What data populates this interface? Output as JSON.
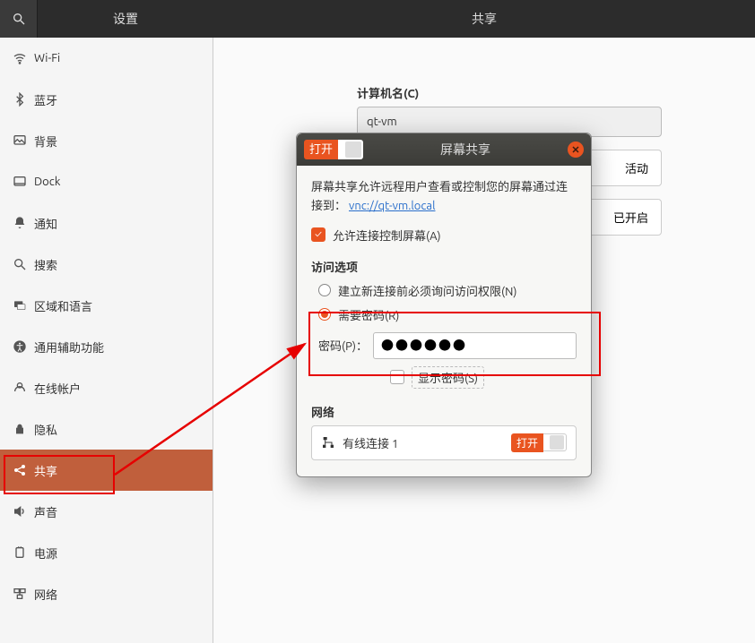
{
  "topbar": {
    "sidebar_title": "设置",
    "page_title": "共享"
  },
  "sidebar": {
    "items": [
      {
        "label": "Wi-Fi",
        "icon": "wifi-icon"
      },
      {
        "label": "蓝牙",
        "icon": "bluetooth-icon"
      },
      {
        "label": "背景",
        "icon": "background-icon"
      },
      {
        "label": "Dock",
        "icon": "dock-icon"
      },
      {
        "label": "通知",
        "icon": "bell-icon"
      },
      {
        "label": "搜索",
        "icon": "search-icon"
      },
      {
        "label": "区域和语言",
        "icon": "language-icon"
      },
      {
        "label": "通用辅助功能",
        "icon": "accessibility-icon"
      },
      {
        "label": "在线帐户",
        "icon": "online-accounts-icon"
      },
      {
        "label": "隐私",
        "icon": "privacy-icon"
      },
      {
        "label": "共享",
        "icon": "share-icon",
        "active": true
      },
      {
        "label": "声音",
        "icon": "sound-icon"
      },
      {
        "label": "电源",
        "icon": "power-icon"
      },
      {
        "label": "网络",
        "icon": "network-icon"
      }
    ]
  },
  "content": {
    "computer_name_label": "计算机名(C)",
    "computer_name_value": "qt-vm",
    "row1_status": "活动",
    "row2_status": "已开启"
  },
  "dialog": {
    "toggle_label": "打开",
    "title": "屏幕共享",
    "desc_prefix": "屏幕共享允许远程用户查看或控制您的屏幕通过连接到：",
    "vnc_link": "vnc://qt-vm.local",
    "allow_control": "允许连接控制屏幕(A)",
    "access_heading": "访问选项",
    "opt_ask": "建立新连接前必须询问访问权限(N)",
    "opt_password": "需要密码(R)",
    "password_label": "密码(P)：",
    "password_value": "●●●●●●",
    "show_password": "显示密码(S)",
    "network_heading": "网络",
    "conn_name": "有线连接 1",
    "conn_toggle_label": "打开"
  }
}
